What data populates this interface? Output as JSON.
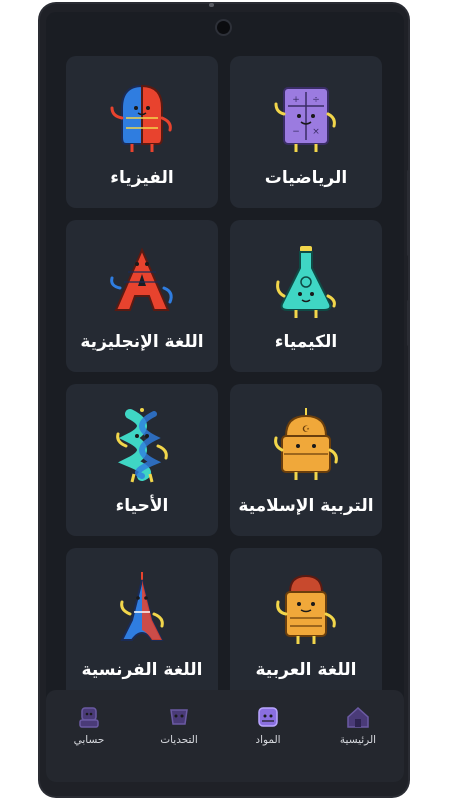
{
  "subjects": [
    {
      "label": "الرياضيات",
      "icon": "math-book-icon"
    },
    {
      "label": "الفيزياء",
      "icon": "physics-magnet-icon"
    },
    {
      "label": "الكيمياء",
      "icon": "chemistry-flask-icon"
    },
    {
      "label": "اللغة الإنجليزية",
      "icon": "english-letter-a-icon"
    },
    {
      "label": "التربية الإسلامية",
      "icon": "islamic-mosque-icon"
    },
    {
      "label": "الأحياء",
      "icon": "biology-dna-icon"
    },
    {
      "label": "اللغة العربية",
      "icon": "arabic-fez-character-icon"
    },
    {
      "label": "اللغة الفرنسية",
      "icon": "french-eiffel-tower-icon"
    }
  ],
  "nav": {
    "home": "الرئيسية",
    "subjects": "المواد",
    "challenges": "التحديات",
    "account": "حسابي"
  },
  "colors": {
    "background": "#1a1d23",
    "card": "#252a33",
    "nav": "#24272e",
    "nav_icon": "#5b4a8c"
  }
}
